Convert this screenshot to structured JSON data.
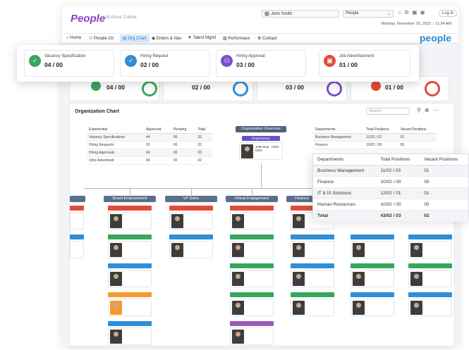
{
  "app": {
    "logo": "People",
    "logo_sub": "All About Culture",
    "user": "John Smith",
    "module": "People",
    "login_label": "Log in",
    "datetime": "Monday, November 20, 2023 :: 11:34 AM",
    "brand": "people"
  },
  "menu": [
    {
      "label": "Home",
      "icon": "home-icon"
    },
    {
      "label": "People Ctr",
      "icon": "people-icon"
    },
    {
      "label": "Org Chart",
      "icon": "org-chart-icon",
      "active": true
    },
    {
      "label": "Enters & Nav",
      "icon": "enter-icon"
    },
    {
      "label": "Talent Mgmt",
      "icon": "talent-icon"
    },
    {
      "label": "Performace",
      "icon": "chart-icon"
    },
    {
      "label": "Contact",
      "icon": "gear-icon"
    }
  ],
  "summary_cards": [
    {
      "title": "Vacancy Specification",
      "count": "04 / 00",
      "color": "#3aa55d",
      "icon": "check-icon"
    },
    {
      "title": "Hiring Request",
      "count": "02 / 00",
      "color": "#2f8ed8",
      "icon": "check-icon"
    },
    {
      "title": "Hiring Approval",
      "count": "03 / 00",
      "color": "#7a4fd0",
      "icon": "approval-icon"
    },
    {
      "title": "Job Advertisement",
      "count": "01 / 00",
      "color": "#e24b3a",
      "icon": "advert-icon"
    }
  ],
  "bg_cards": [
    {
      "count": "04 / 00",
      "color": "#3aa55d"
    },
    {
      "count": "02 / 00",
      "color": "#2f8ed8"
    },
    {
      "count": "03 / 00",
      "color": "#7a4fd0"
    },
    {
      "count": "01 / 00",
      "color": "#e24b3a"
    }
  ],
  "org_chart": {
    "title": "Organization Chart",
    "search_placeholder": "Search",
    "overview_title": "Organization Overview",
    "overview_dept": "Departments",
    "ceo_name": "John Doe - CEO",
    "ceo_sub": "CEO",
    "experiential": {
      "headers": [
        "Experiential",
        "Approved",
        "Pending",
        "Total"
      ],
      "rows": [
        [
          "Vacancy Specifications",
          "44",
          "00",
          "33"
        ],
        [
          "Hiring Requests",
          "02",
          "00",
          "02"
        ],
        [
          "Hiring Approvals",
          "04",
          "00",
          "03"
        ],
        [
          "Jobs Advertised",
          "04",
          "00",
          "02"
        ]
      ]
    },
    "dept_small": {
      "headers": [
        "Departments",
        "Total Positions",
        "Vacant Positions"
      ],
      "rows": [
        [
          "Business Management",
          "11/02 / 03",
          "01"
        ],
        [
          "Finance",
          "10/02 / 00",
          "00"
        ]
      ]
    },
    "columns": [
      {
        "head": "Board Endorsement"
      },
      {
        "head": "VP Sales"
      },
      {
        "head": "Virtual Engagement"
      },
      {
        "head": "Finance"
      }
    ]
  },
  "dept_table": {
    "headers": [
      "Departments",
      "Total Positions",
      "Vacant Positions"
    ],
    "rows": [
      [
        "Business Management",
        "11/02 / 03",
        "01"
      ],
      [
        "Finance",
        "10/02 / 00",
        "00"
      ],
      [
        "IT & IS Solutions",
        "12/02 / 01",
        "01"
      ],
      [
        "Human Resources",
        "10/02 / 00",
        "00"
      ]
    ],
    "total": [
      "Total",
      "43/02 / 03",
      "02"
    ]
  },
  "colors": {
    "accent": "#8a3fc5",
    "link": "#2a78c9",
    "green": "#3aa55d",
    "red": "#e24b3a",
    "blue": "#2f8ed8",
    "purple": "#7a4fd0",
    "orange": "#f39b2e"
  }
}
